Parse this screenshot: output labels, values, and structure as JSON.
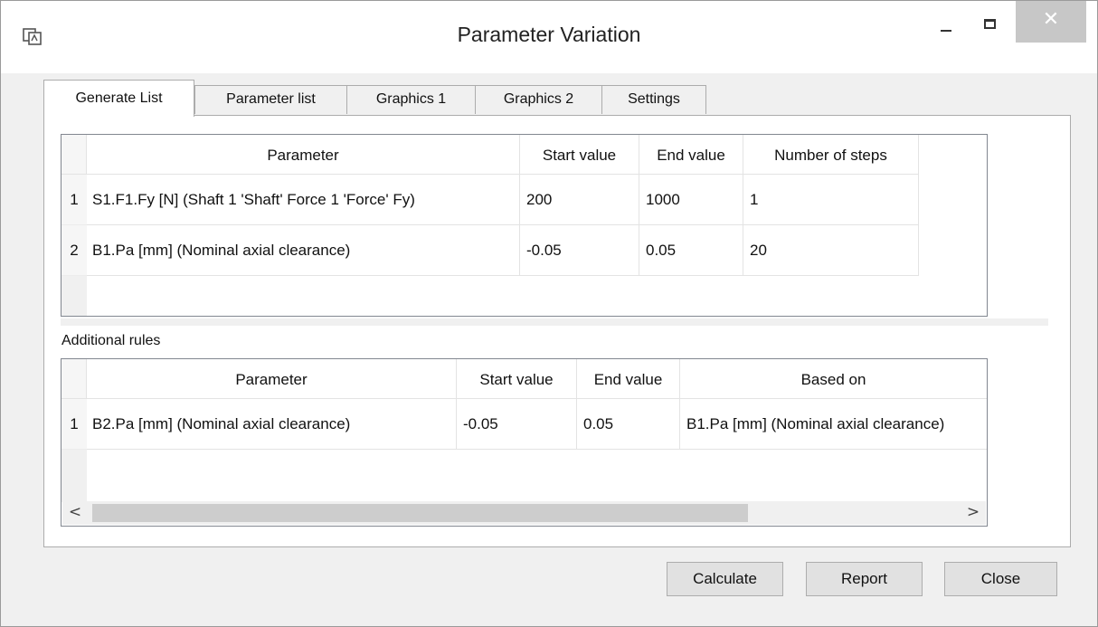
{
  "window": {
    "title": "Parameter Variation",
    "close_glyph": "✕"
  },
  "tabs": [
    {
      "label": "Generate List",
      "active": true
    },
    {
      "label": "Parameter list"
    },
    {
      "label": "Graphics 1"
    },
    {
      "label": "Graphics 2"
    },
    {
      "label": "Settings"
    }
  ],
  "parameters_table": {
    "columns": [
      "Parameter",
      "Start value",
      "End value",
      "Number of steps"
    ],
    "rows": [
      {
        "num": "1",
        "parameter": "S1.F1.Fy [N]  (Shaft 1 'Shaft' Force 1 'Force' Fy)",
        "start": "200",
        "end": "1000",
        "steps": "1"
      },
      {
        "num": "2",
        "parameter": "B1.Pa [mm]  (Nominal axial clearance)",
        "start": "-0.05",
        "end": "0.05",
        "steps": "20"
      }
    ]
  },
  "additional_rules": {
    "label": "Additional rules",
    "columns": [
      "Parameter",
      "Start value",
      "End value",
      "Based on"
    ],
    "rows": [
      {
        "num": "1",
        "parameter": "B2.Pa [mm]  (Nominal axial clearance)",
        "start": "-0.05",
        "end": "0.05",
        "based_on": "B1.Pa [mm]  (Nominal axial clearance)"
      }
    ],
    "scroll_left": "<",
    "scroll_right": ">"
  },
  "footer": {
    "calculate": "Calculate",
    "report": "Report",
    "close": "Close"
  },
  "colors": {
    "icon_blue": "#5aa7e6",
    "icon_border": "#1f6fb4",
    "close_button": "#c7c7c7"
  },
  "icons": [
    "app-icon",
    "add-icon",
    "remove-icon",
    "delete-icon"
  ]
}
